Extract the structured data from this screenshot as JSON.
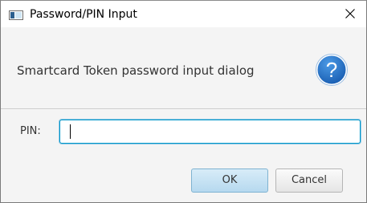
{
  "window": {
    "title": "Password/PIN Input"
  },
  "header": {
    "text": "Smartcard Token password input dialog",
    "icon": "help-icon",
    "icon_color": "#1f6fc5"
  },
  "form": {
    "pin_label": "PIN:",
    "pin_value": ""
  },
  "buttons": {
    "ok_label": "OK",
    "cancel_label": "Cancel"
  },
  "colors": {
    "focus_border": "#0096c9",
    "default_button": "#b6d9ef"
  }
}
